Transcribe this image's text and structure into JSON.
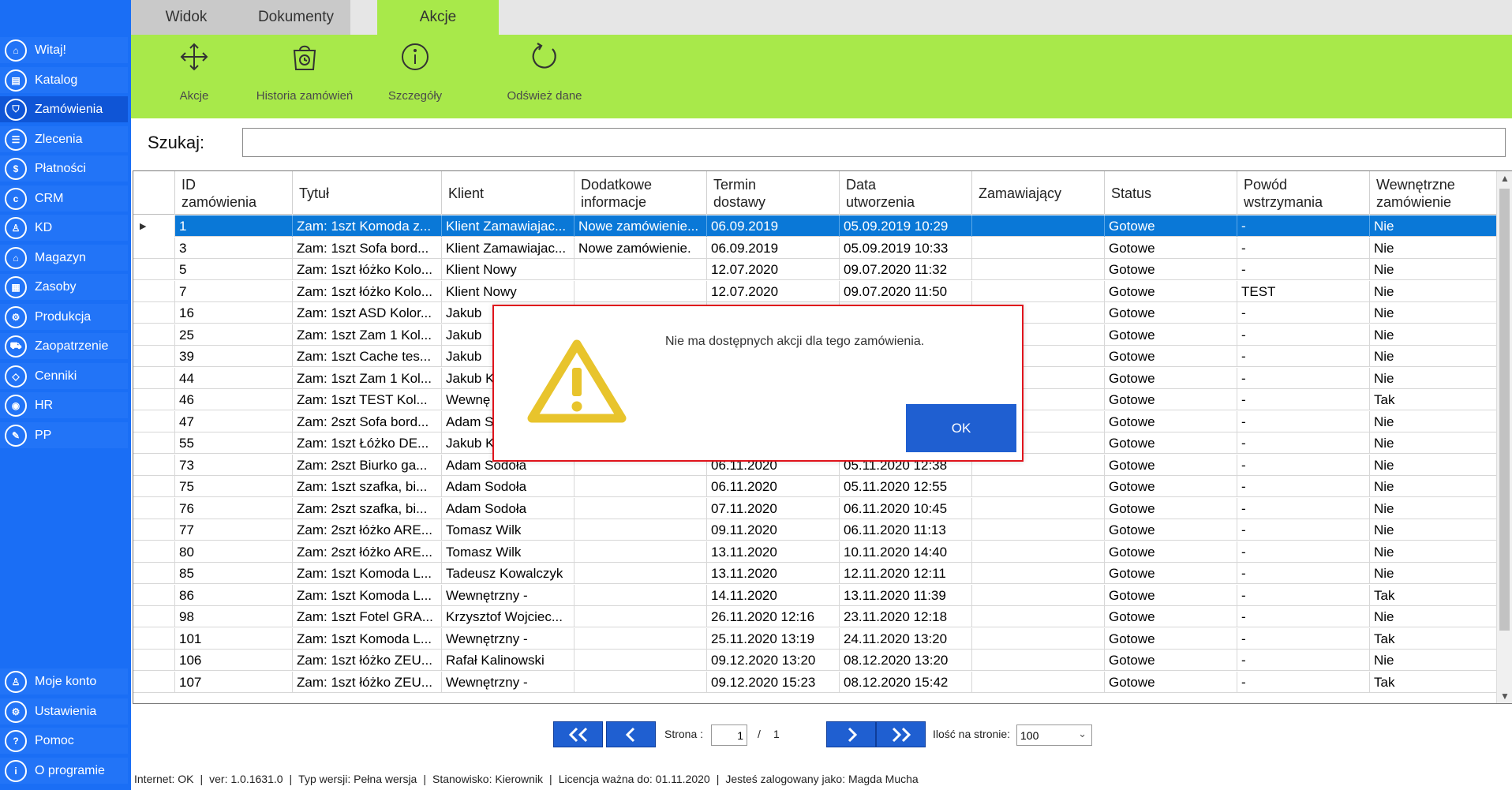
{
  "sidebar": {
    "items": [
      {
        "label": "Witaj!",
        "icon": "home-icon",
        "glyph": "⌂"
      },
      {
        "label": "Katalog",
        "icon": "book-icon",
        "glyph": "▤"
      },
      {
        "label": "Zamówienia",
        "icon": "cart-icon",
        "glyph": "⛉"
      },
      {
        "label": "Zlecenia",
        "icon": "list-icon",
        "glyph": "☰"
      },
      {
        "label": "Płatności",
        "icon": "dollar-icon",
        "glyph": "$"
      },
      {
        "label": "CRM",
        "icon": "crm-icon",
        "glyph": "c"
      },
      {
        "label": "KD",
        "icon": "person-icon",
        "glyph": "♙"
      },
      {
        "label": "Magazyn",
        "icon": "warehouse-icon",
        "glyph": "⌂"
      },
      {
        "label": "Zasoby",
        "icon": "resources-icon",
        "glyph": "▦"
      },
      {
        "label": "Produkcja",
        "icon": "production-icon",
        "glyph": "⚙"
      },
      {
        "label": "Zaopatrzenie",
        "icon": "truck-icon",
        "glyph": "⛟"
      },
      {
        "label": "Cenniki",
        "icon": "tag-icon",
        "glyph": "◇"
      },
      {
        "label": "HR",
        "icon": "hr-icon",
        "glyph": "◉"
      },
      {
        "label": "PP",
        "icon": "pp-icon",
        "glyph": "✎"
      }
    ],
    "bottom": [
      {
        "label": "Moje konto",
        "icon": "account-icon",
        "glyph": "♙"
      },
      {
        "label": "Ustawienia",
        "icon": "gear-icon",
        "glyph": "⚙"
      },
      {
        "label": "Pomoc",
        "icon": "help-icon",
        "glyph": "?"
      },
      {
        "label": "O programie",
        "icon": "info-icon",
        "glyph": "i"
      }
    ]
  },
  "tabs": [
    "Widok",
    "Dokumenty",
    "Akcje"
  ],
  "ribbon": {
    "akcje": "Akcje",
    "historia": "Historia zamówień",
    "szczegoly": "Szczegóły",
    "odswiez": "Odśwież dane"
  },
  "search": {
    "label": "Szukaj:",
    "value": ""
  },
  "table": {
    "headers": [
      "ID\nzamówienia",
      "Tytuł",
      "Klient",
      "Dodatkowe\ninformacje",
      "Termin\ndostawy",
      "Data\nutworzenia",
      "Zamawiający",
      "Status",
      "Powód\nwstrzymania",
      "Wewnętrzne\nzamówienie"
    ],
    "rows": [
      [
        "1",
        "Zam: 1szt Komoda z...",
        "Klient Zamawiajac...",
        "Nowe zamówienie...",
        "06.09.2019",
        "05.09.2019 10:29",
        "",
        "Gotowe",
        "-",
        "Nie"
      ],
      [
        "3",
        "Zam: 1szt Sofa bord...",
        "Klient Zamawiajac...",
        "Nowe zamówienie.",
        "06.09.2019",
        "05.09.2019 10:33",
        "",
        "Gotowe",
        "-",
        "Nie"
      ],
      [
        "5",
        "Zam: 1szt łóżko Kolo...",
        "Klient Nowy",
        "",
        "12.07.2020",
        "09.07.2020 11:32",
        "",
        "Gotowe",
        "-",
        "Nie"
      ],
      [
        "7",
        "Zam: 1szt łóżko Kolo...",
        "Klient Nowy",
        "",
        "12.07.2020",
        "09.07.2020 11:50",
        "",
        "Gotowe",
        "TEST",
        "Nie"
      ],
      [
        "16",
        "Zam: 1szt ASD Kolor...",
        "Jakub",
        "",
        "",
        "",
        "",
        "Gotowe",
        "-",
        "Nie"
      ],
      [
        "25",
        "Zam: 1szt Zam 1 Kol...",
        "Jakub",
        "",
        "",
        "",
        "",
        "Gotowe",
        "-",
        "Nie"
      ],
      [
        "39",
        "Zam: 1szt Cache tes...",
        "Jakub",
        "",
        "",
        "",
        "",
        "Gotowe",
        "-",
        "Nie"
      ],
      [
        "44",
        "Zam: 1szt Zam 1 Kol...",
        "Jakub K",
        "",
        "",
        "",
        "",
        "Gotowe",
        "-",
        "Nie"
      ],
      [
        "46",
        "Zam: 1szt TEST Kol...",
        "Wewnę",
        "",
        "",
        "",
        "",
        "Gotowe",
        "-",
        "Tak"
      ],
      [
        "47",
        "Zam: 2szt Sofa bord...",
        "Adam S",
        "",
        "",
        "",
        "",
        "Gotowe",
        "-",
        "Nie"
      ],
      [
        "55",
        "Zam: 1szt Łóżko DE...",
        "Jakub K",
        "",
        "",
        "",
        "",
        "Gotowe",
        "-",
        "Nie"
      ],
      [
        "73",
        "Zam: 2szt Biurko ga...",
        "Adam Sodoła",
        "",
        "06.11.2020",
        "05.11.2020 12:38",
        "",
        "Gotowe",
        "-",
        "Nie"
      ],
      [
        "75",
        "Zam: 1szt szafka, bi...",
        "Adam Sodoła",
        "",
        "06.11.2020",
        "05.11.2020 12:55",
        "",
        "Gotowe",
        "-",
        "Nie"
      ],
      [
        "76",
        "Zam: 2szt szafka, bi...",
        "Adam Sodoła",
        "",
        "07.11.2020",
        "06.11.2020 10:45",
        "",
        "Gotowe",
        "-",
        "Nie"
      ],
      [
        "77",
        "Zam: 2szt łóżko ARE...",
        "Tomasz Wilk",
        "",
        "09.11.2020",
        "06.11.2020 11:13",
        "",
        "Gotowe",
        "-",
        "Nie"
      ],
      [
        "80",
        "Zam: 2szt łóżko ARE...",
        "Tomasz Wilk",
        "",
        "13.11.2020",
        "10.11.2020 14:40",
        "",
        "Gotowe",
        "-",
        "Nie"
      ],
      [
        "85",
        "Zam: 1szt Komoda L...",
        "Tadeusz Kowalczyk",
        "",
        "13.11.2020",
        "12.11.2020 12:11",
        "",
        "Gotowe",
        "-",
        "Nie"
      ],
      [
        "86",
        "Zam: 1szt Komoda L...",
        "Wewnętrzny -",
        "",
        "14.11.2020",
        "13.11.2020 11:39",
        "",
        "Gotowe",
        "-",
        "Tak"
      ],
      [
        "98",
        "Zam: 1szt Fotel GRA...",
        "Krzysztof Wojciec...",
        "",
        "26.11.2020 12:16",
        "23.11.2020 12:18",
        "",
        "Gotowe",
        "-",
        "Nie"
      ],
      [
        "101",
        "Zam: 1szt Komoda L...",
        "Wewnętrzny -",
        "",
        "25.11.2020 13:19",
        "24.11.2020 13:20",
        "",
        "Gotowe",
        "-",
        "Tak"
      ],
      [
        "106",
        "Zam: 1szt łóżko ZEU...",
        "Rafał  Kalinowski",
        "",
        "09.12.2020 13:20",
        "08.12.2020 13:20",
        "",
        "Gotowe",
        "-",
        "Nie"
      ],
      [
        "107",
        "Zam: 1szt łóżko ZEU...",
        "Wewnętrzny -",
        "",
        "09.12.2020 15:23",
        "08.12.2020 15:42",
        "",
        "Gotowe",
        "-",
        "Tak"
      ]
    ]
  },
  "pager": {
    "page_label": "Strona :",
    "page": "1",
    "sep": "/",
    "total": "1",
    "perpage_label": "Ilość na stronie:",
    "perpage_value": "100"
  },
  "status": {
    "internet": "Internet: OK",
    "version": "ver: 1.0.1631.0",
    "type": "Typ wersji: Pełna wersja",
    "station": "Stanowisko: Kierownik",
    "license": "Licencja ważna do: 01.11.2020",
    "user": "Jesteś zalogowany jako: Magda Mucha"
  },
  "dialog": {
    "message": "Nie ma dostępnych akcji dla tego zamówienia.",
    "ok": "OK"
  },
  "colors": {
    "sidebar": "#1a6ef5",
    "ribbon": "#a8e94a",
    "selection": "#0a78d7",
    "dialog_border": "#e0141c",
    "warning": "#e8c42c"
  }
}
